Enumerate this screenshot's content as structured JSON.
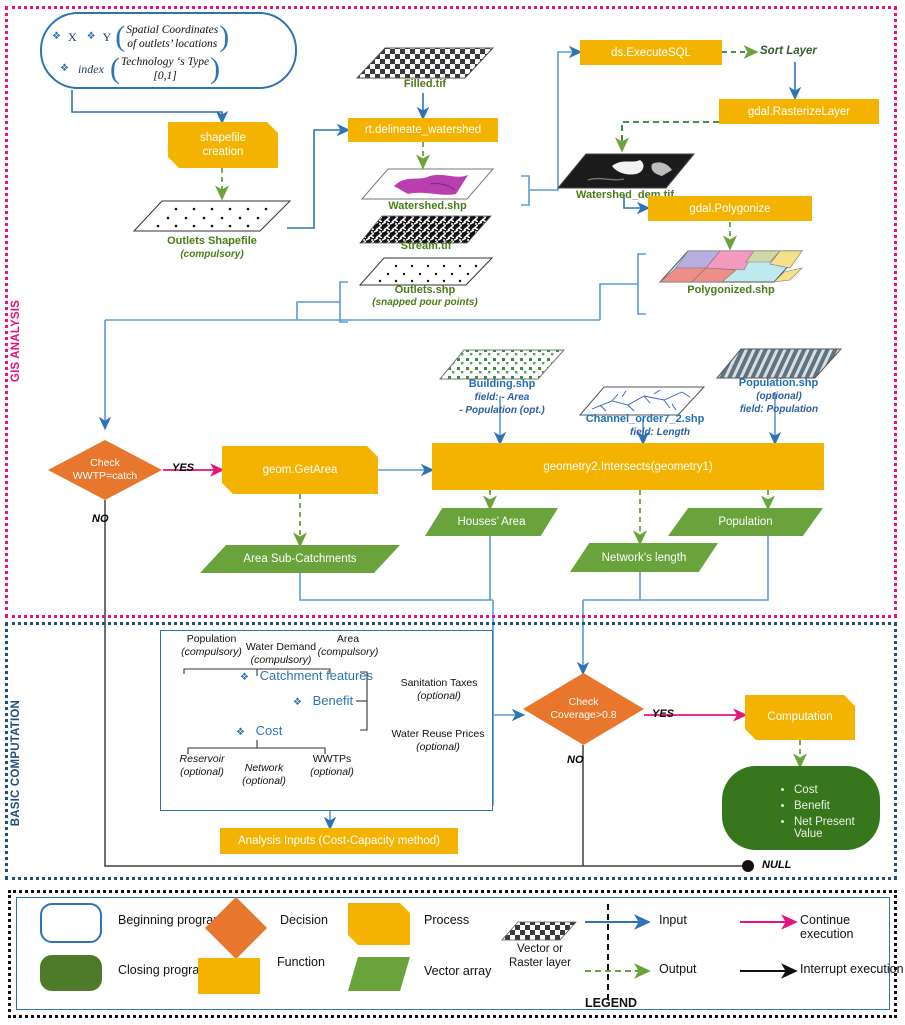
{
  "sections": {
    "gis_label": "GIS ANALYSIS",
    "basic_label": "BASIC COMPUTATION",
    "legend_title": "LEGEND"
  },
  "start_node": {
    "var_x": "X",
    "var_y": "Y",
    "var_index": "index",
    "desc_1": "Spatial Coordinates\nof outlets’ locations",
    "desc_2": "Technology ‘s Type\n[0,1]"
  },
  "gis": {
    "shapefile_creation": "shapefile\ncreation",
    "outlets_shapefile": "Outlets Shapefile",
    "outlets_shapefile_sub": "(compulsory)",
    "filled_tif": "Filled.tif",
    "delineate": "rt.delineate_watershed",
    "watershed_shp": "Watershed.shp",
    "stream_tif": "Stream.tif",
    "outlets_shp": "Outlets.shp",
    "outlets_shp_sub": "(snapped pour points)",
    "execute_sql": "ds.ExecuteSQL",
    "sort_layer": "Sort Layer",
    "rasterize_layer": "gdal.RasterizeLayer",
    "watershed_dem": "Watershed_dem.tif",
    "polygonize": "gdal.Polygonize",
    "polygonized_shp": "Polygonized.shp"
  },
  "layers": {
    "building_shp": "Building.shp",
    "building_sub": "field: - Area\n- Population (opt.)",
    "channel_shp": "Channel_order7_2.shp",
    "channel_sub": "field: Length",
    "population_shp": "Population.shp",
    "population_sub": "(optional)\nfield: Population"
  },
  "decisions": {
    "check_wwtp": "Check\nWWTP=catch",
    "check_coverage": "Check\nCoverage>0.8",
    "yes": "YES",
    "no": "NO"
  },
  "functions": {
    "get_area": "geom.GetArea",
    "intersects": "geometry2.Intersects(geometry1)",
    "computation": "Computation",
    "analysis_inputs": "Analysis Inputs (Cost-Capacity method)"
  },
  "arrays": {
    "area_sub_catchments": "Area Sub-Catchments",
    "houses_area": "Houses’ Area",
    "network_length": "Network’s length",
    "population": "Population"
  },
  "closing": {
    "items": [
      "Cost",
      "Benefit",
      "Net Present Value"
    ]
  },
  "null_label": "NULL",
  "calc": {
    "population": "Population",
    "population_sub": "(compulsory)",
    "water_demand": "Water Demand",
    "water_demand_sub": "(compulsory)",
    "area": "Area",
    "area_sub": "(compulsory)",
    "catchment_features": "Catchment features",
    "benefit": "Benefit",
    "cost": "Cost",
    "sanitation_taxes": "Sanitation Taxes",
    "sanitation_taxes_sub": "(optional)",
    "water_reuse": "Water Reuse Prices",
    "water_reuse_sub": "(optional)",
    "reservoir": "Reservoir",
    "reservoir_sub": "(optional)",
    "network": "Network",
    "network_sub": "(optional)",
    "wwtps": "WWTPs",
    "wwtps_sub": "(optional)"
  },
  "legend": {
    "beginning_program": "Beginning program",
    "decision": "Decision",
    "process": "Process",
    "closing_program": "Closing program",
    "function": "Function",
    "vector_array": "Vector array",
    "vector_or_raster": "Vector or\nRaster layer",
    "input": "Input",
    "continue_execution": "Continue execution",
    "output": "Output",
    "interrupt_execution": "Interrupt execution"
  },
  "colors": {
    "process": "#f5b301",
    "decision": "#e8762c",
    "vector_array": "#6aa33c",
    "closing": "#38761d",
    "input_arrow": "#2e74b5",
    "output_arrow": "#6aa33c",
    "continue_arrow": "#e8117f",
    "interrupt_arrow": "#111111",
    "gis_frame": "#e8117f",
    "basic_frame": "#1f4e79"
  }
}
